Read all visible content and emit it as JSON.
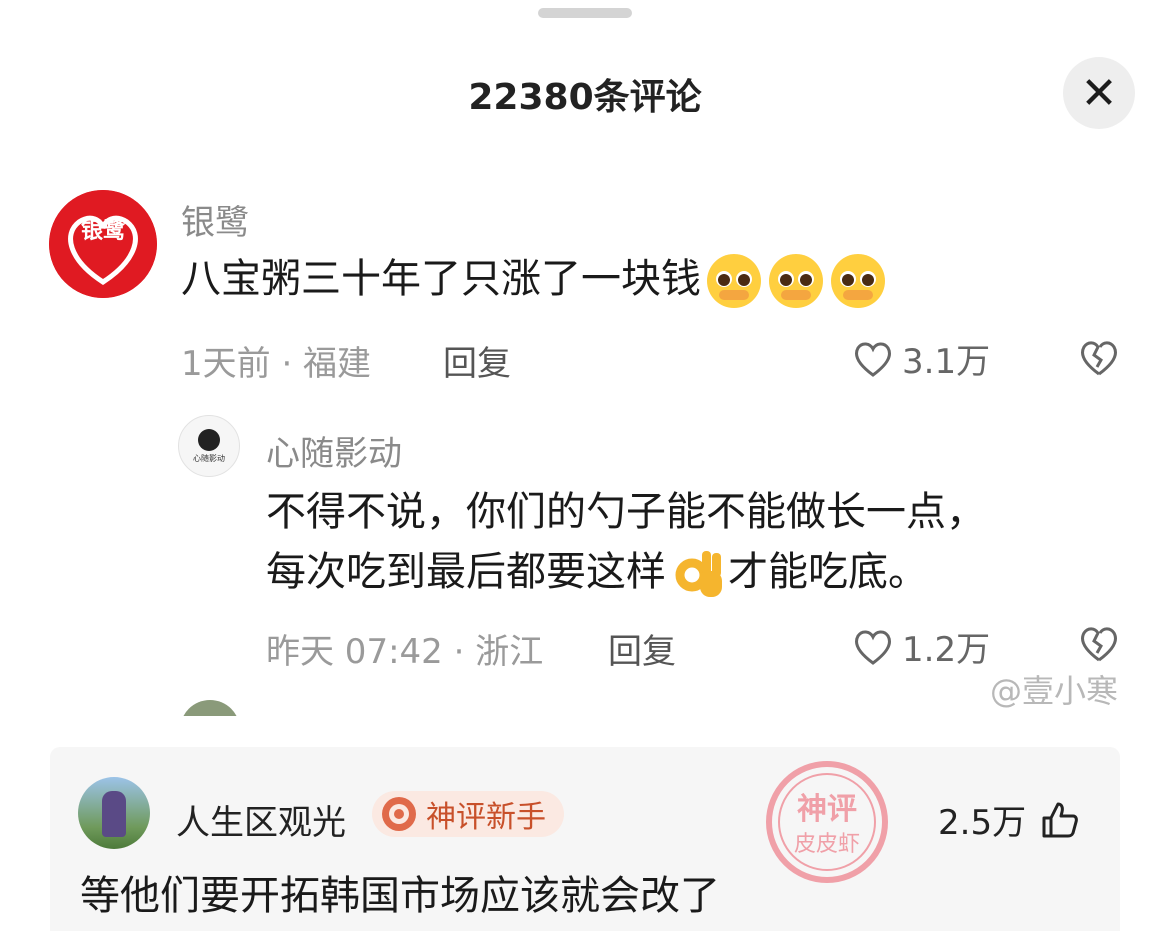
{
  "header": {
    "title": "22380条评论"
  },
  "comments": [
    {
      "user": "银鹭",
      "avatar_text": "银鹭",
      "text": "八宝粥三十年了只涨了一块钱",
      "emojis": [
        "pleading-face-emoji",
        "pleading-face-emoji",
        "pleading-face-emoji"
      ],
      "meta": "1天前 · 福建",
      "reply_label": "回复",
      "likes": "3.1万"
    }
  ],
  "replies": [
    {
      "user": "心随影动",
      "avatar_text": "心随影动",
      "text_line1": "不得不说，你们的勺子能不能做长一点，",
      "text_line2_before": "每次吃到最后都要这样",
      "text_line2_after": "才能吃底。",
      "emoji": "ok-hand-emoji",
      "meta": "昨天 07:42 · 浙江",
      "reply_label": "回复",
      "likes": "1.2万"
    }
  ],
  "watermark": "@壹小寒",
  "featured": {
    "user": "人生区观光",
    "badge": "神评新手",
    "likes": "2.5万",
    "text": "等他们要开拓韩国市场应该就会改了",
    "stamp_line1": "神评",
    "stamp_line2": "皮皮虾"
  },
  "colors": {
    "brand_red": "#e01a22",
    "badge_bg": "#fbe9e2",
    "badge_text": "#c8502a",
    "meta_gray": "#9a9a9a"
  }
}
